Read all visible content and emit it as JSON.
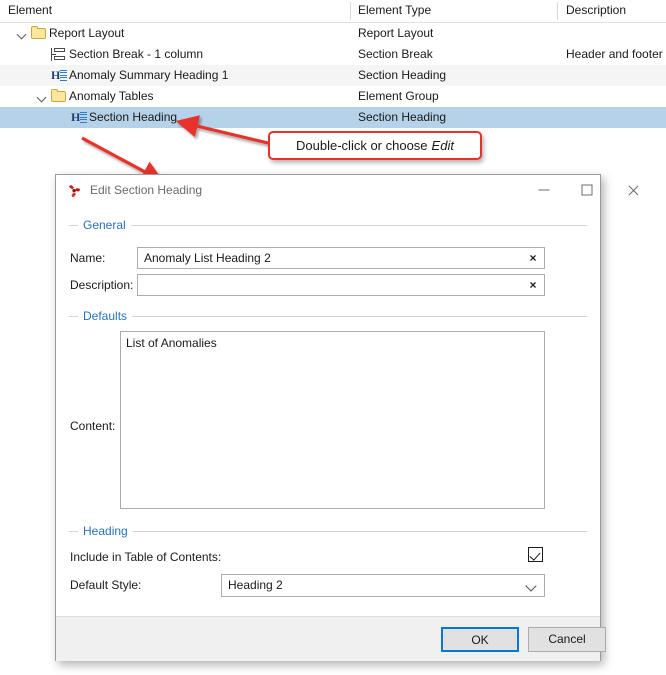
{
  "treeview": {
    "columns": [
      "Element",
      "Element Type",
      "Description"
    ],
    "rows": [
      {
        "indent": 1,
        "twisty": "expanded",
        "icon": "folder-icon",
        "name": "Report Layout",
        "type": "Report Layout",
        "description": "",
        "state": "normal"
      },
      {
        "indent": 2,
        "twisty": "none",
        "icon": "section-break-icon",
        "name": "Section Break - 1 column",
        "type": "Section Break",
        "description": "Header and footer",
        "state": "normal"
      },
      {
        "indent": 2,
        "twisty": "none",
        "icon": "heading-icon",
        "name": "Anomaly Summary Heading 1",
        "type": "Section Heading",
        "description": "",
        "state": "alt"
      },
      {
        "indent": 2,
        "twisty": "expanded",
        "icon": "folder-icon",
        "name": "Anomaly Tables",
        "type": "Element Group",
        "description": "",
        "state": "normal"
      },
      {
        "indent": 3,
        "twisty": "none",
        "icon": "heading-icon",
        "name": "Section Heading",
        "type": "Section Heading",
        "description": "",
        "state": "selected"
      }
    ]
  },
  "callout": {
    "text": "Double-click or choose",
    "emphasis": "Edit",
    "border_color": "#e8312a"
  },
  "dialog": {
    "title": "Edit Section Heading",
    "app_icon": "application-icon",
    "window_buttons": {
      "minimize": "minimize-icon",
      "maximize": "maximize-icon",
      "close": "close-icon"
    },
    "groups": {
      "general": {
        "label": "General",
        "name_label": "Name:",
        "name_value": "Anomaly List Heading 2",
        "name_clear": "×",
        "description_label": "Description:",
        "description_value": "",
        "description_clear": "×"
      },
      "defaults": {
        "label": "Defaults",
        "content_label": "Content:",
        "content_value": "List of Anomalies"
      },
      "heading": {
        "label": "Heading",
        "toc_label": "Include in Table of Contents:",
        "toc_checked": true,
        "style_label": "Default Style:",
        "style_value": "Heading 2"
      }
    },
    "footer": {
      "ok_label": "OK",
      "cancel_label": "Cancel",
      "focus_color": "#0078d7"
    }
  }
}
